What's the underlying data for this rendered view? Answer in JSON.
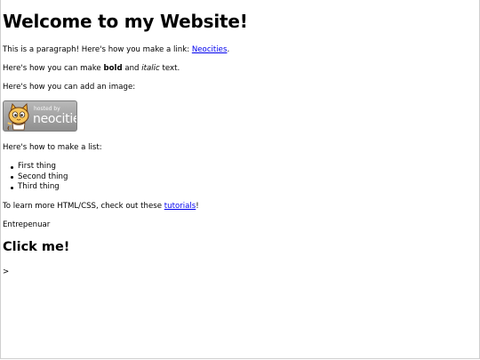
{
  "heading": "Welcome to my Website!",
  "para_link": {
    "before": "This is a paragraph! Here's how you make a link: ",
    "link_text": "Neocities",
    "after": "."
  },
  "para_format": {
    "before": "Here's how you can make ",
    "bold": "bold",
    "middle": " and ",
    "italic": "italic",
    "after": " text."
  },
  "para_image": "Here's how you can add an image:",
  "image_badge": {
    "hosted_by": "hosted by",
    "name": "neocities"
  },
  "para_list": "Here's how to make a list:",
  "list_items": [
    "First thing",
    "Second thing",
    "Third thing"
  ],
  "para_tutorial": {
    "before": "To learn more HTML/CSS, check out these ",
    "link_text": "tutorials",
    "after": "!"
  },
  "para_entrepenuar": "Entrepenuar",
  "click_heading": "Click me!",
  "trailing_text": ">"
}
